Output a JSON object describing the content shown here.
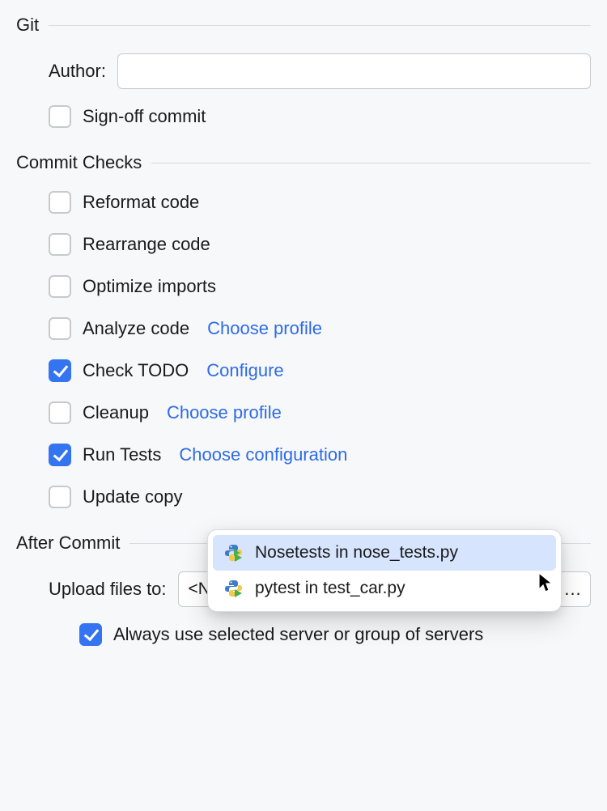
{
  "sections": {
    "git": {
      "title": "Git",
      "author_label": "Author:",
      "author_value": "",
      "signoff_label": "Sign-off commit",
      "signoff_checked": false
    },
    "commit_checks": {
      "title": "Commit Checks",
      "items": [
        {
          "label": "Reformat code",
          "checked": false,
          "link": null
        },
        {
          "label": "Rearrange code",
          "checked": false,
          "link": null
        },
        {
          "label": "Optimize imports",
          "checked": false,
          "link": null
        },
        {
          "label": "Analyze code",
          "checked": false,
          "link": "Choose profile"
        },
        {
          "label": "Check TODO",
          "checked": true,
          "link": "Configure"
        },
        {
          "label": "Cleanup",
          "checked": false,
          "link": "Choose profile"
        },
        {
          "label": "Run Tests",
          "checked": true,
          "link": "Choose configuration"
        },
        {
          "label": "Update copy",
          "checked": false,
          "link": null
        }
      ]
    },
    "after_commit": {
      "title": "After Commit",
      "upload_label": "Upload files to:",
      "upload_value": "<None>",
      "dots": "...",
      "always_label": "Always use selected server or group of servers",
      "always_checked": true
    }
  },
  "popup": {
    "items": [
      {
        "label": "Nosetests in nose_tests.py",
        "selected": true,
        "icon": "python-run-icon"
      },
      {
        "label": "pytest in test_car.py",
        "selected": false,
        "icon": "python-run-icon"
      }
    ]
  }
}
